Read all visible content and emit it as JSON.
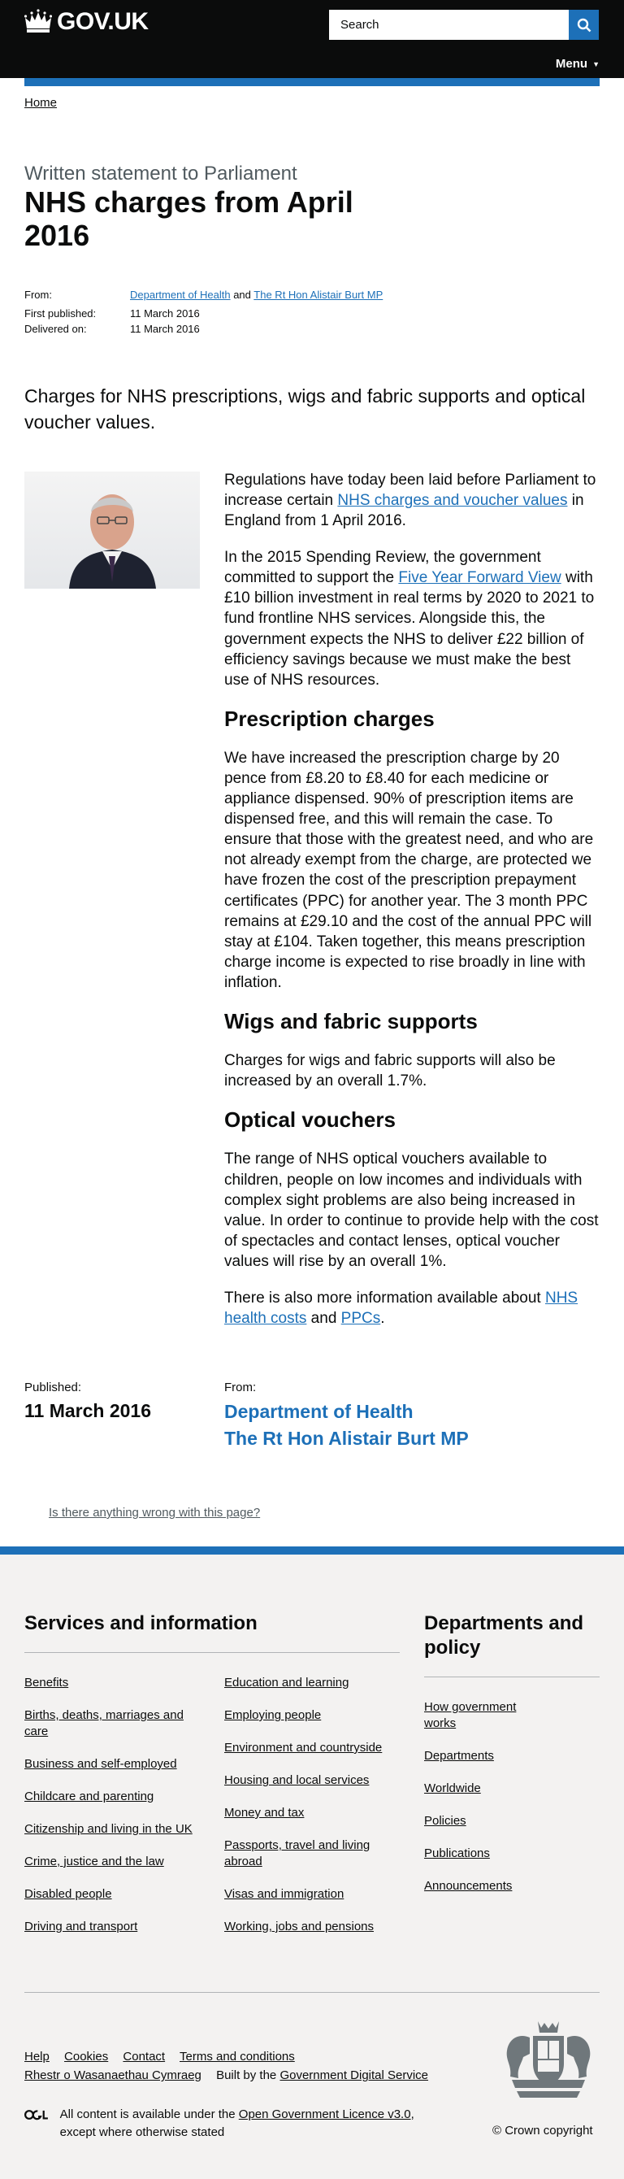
{
  "header": {
    "logo_text": "GOV.UK",
    "search_placeholder": "Search",
    "menu_label": "Menu"
  },
  "breadcrumb": {
    "home": "Home"
  },
  "title": {
    "context": "Written statement to Parliament",
    "heading": "NHS charges from April 2016"
  },
  "meta": {
    "from_label": "From:",
    "org1": "Department of Health",
    "and": "and",
    "org2": "The Rt Hon Alistair Burt MP",
    "first_published_label": "First published:",
    "first_published": "11 March 2016",
    "delivered_label": "Delivered on:",
    "delivered": "11 March 2016"
  },
  "description": "Charges for NHS prescriptions, wigs and fabric supports and optical voucher values.",
  "body": {
    "p1_a": "Regulations have today been laid before Parliament to increase certain ",
    "p1_link": "NHS charges and voucher values",
    "p1_b": " in England from 1 April 2016.",
    "p2_a": "In the 2015 Spending Review, the government committed to support the ",
    "p2_link": "Five Year Forward View",
    "p2_b": " with £10 billion investment in real terms by 2020 to 2021 to fund frontline NHS services. Alongside this, the government expects the NHS to deliver £22 billion of efficiency savings because we must make the best use of NHS resources.",
    "h_prescription": "Prescription charges",
    "p_prescription": "We have increased the prescription charge by 20 pence from £8.20 to £8.40 for each medicine or appliance dispensed. 90% of prescription items are dispensed free, and this will remain the case. To ensure that those with the greatest need, and who are not already exempt from the charge, are protected we have frozen the cost of the prescription prepayment certificates (PPC) for another year. The 3 month PPC remains at £29.10 and the cost of the annual PPC will stay at £104. Taken together, this means prescription charge income is expected to rise broadly in line with inflation.",
    "h_wigs": "Wigs and fabric supports",
    "p_wigs": "Charges for wigs and fabric supports will also be increased by an overall 1.7%.",
    "h_optical": "Optical vouchers",
    "p_optical": "The range of NHS optical vouchers available to children, people on low incomes and individuals with complex sight problems are also being increased in value. In order to continue to provide help with the cost of spectacles and contact lenses, optical voucher values will rise by an overall 1%.",
    "p_more_a": "There is also more information available about ",
    "p_more_link1": "NHS health costs",
    "p_more_and": " and ",
    "p_more_link2": "PPCs",
    "p_more_end": "."
  },
  "published": {
    "label": "Published:",
    "date": "11 March 2016",
    "from_label": "From:",
    "org1": "Department of Health",
    "org2": "The Rt Hon Alistair Burt MP"
  },
  "report_link": "Is there anything wrong with this page?",
  "footer": {
    "services_heading": "Services and information",
    "services_col1": [
      "Benefits",
      "Births, deaths, marriages and care",
      "Business and self-employed",
      "Childcare and parenting",
      "Citizenship and living in the UK",
      "Crime, justice and the law",
      "Disabled people",
      "Driving and transport"
    ],
    "services_col2": [
      "Education and learning",
      "Employing people",
      "Environment and countryside",
      "Housing and local services",
      "Money and tax",
      "Passports, travel and living abroad",
      "Visas and immigration",
      "Working, jobs and pensions"
    ],
    "departments_heading": "Departments and policy",
    "departments": [
      "How government works",
      "Departments",
      "Worldwide",
      "Policies",
      "Publications",
      "Announcements"
    ],
    "help": "Help",
    "cookies": "Cookies",
    "contact": "Contact",
    "terms": "Terms and conditions",
    "welsh": "Rhestr o Wasanaethau Cymraeg",
    "built_by_prefix": "Built by the ",
    "built_by_link": "Government Digital Service",
    "ogl_prefix": "All content is available under the ",
    "ogl_link": "Open Government Licence v3.0",
    "ogl_suffix": ", except where otherwise stated",
    "copyright": "© Crown copyright"
  }
}
